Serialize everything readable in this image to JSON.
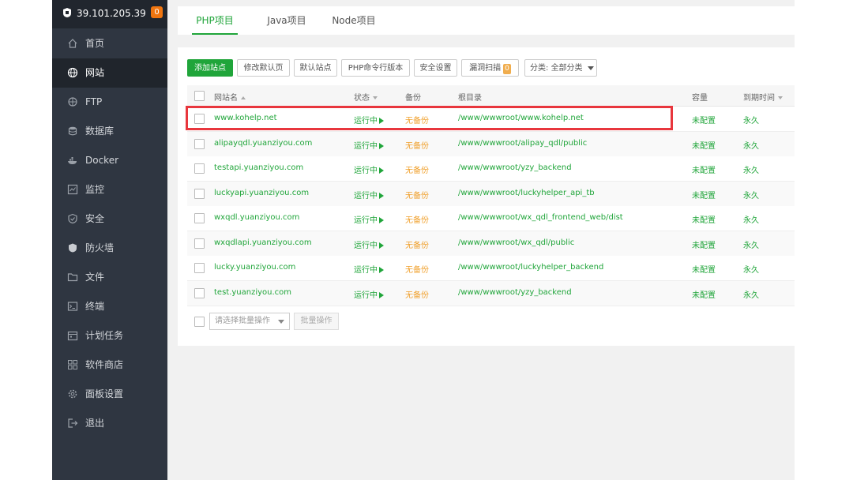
{
  "server": {
    "ip": "39.101.205.39",
    "badge": "0"
  },
  "menu": [
    {
      "label": "首页",
      "icon": "home-icon"
    },
    {
      "label": "网站",
      "icon": "globe-icon",
      "active": true
    },
    {
      "label": "FTP",
      "icon": "ftp-icon"
    },
    {
      "label": "数据库",
      "icon": "database-icon"
    },
    {
      "label": "Docker",
      "icon": "docker-icon"
    },
    {
      "label": "监控",
      "icon": "monitor-icon"
    },
    {
      "label": "安全",
      "icon": "shield-check-icon"
    },
    {
      "label": "防火墙",
      "icon": "firewall-icon"
    },
    {
      "label": "文件",
      "icon": "folder-icon"
    },
    {
      "label": "终端",
      "icon": "terminal-icon"
    },
    {
      "label": "计划任务",
      "icon": "calendar-icon"
    },
    {
      "label": "软件商店",
      "icon": "apps-grid-icon"
    },
    {
      "label": "面板设置",
      "icon": "gear-icon"
    },
    {
      "label": "退出",
      "icon": "logout-icon"
    }
  ],
  "tabs": [
    "PHP项目",
    "Java项目",
    "Node项目"
  ],
  "toolbar": {
    "add_site": "添加站点",
    "edit_default_page": "修改默认页",
    "default_site": "默认站点",
    "php_cli_version": "PHP命令行版本",
    "security_settings": "安全设置",
    "vuln_scan": "漏洞扫描",
    "vuln_count": "0",
    "category_prefix": "分类: ",
    "category_value": "全部分类"
  },
  "table": {
    "headers": {
      "name": "网站名",
      "status": "状态",
      "backup": "备份",
      "root": "根目录",
      "quota": "容量",
      "expire": "到期时间"
    },
    "rows": [
      {
        "name": "www.kohelp.net",
        "status": "运行中",
        "backup": "无备份",
        "root": "/www/wwwroot/www.kohelp.net",
        "quota": "未配置",
        "expire": "永久"
      },
      {
        "name": "alipayqdl.yuanziyou.com",
        "status": "运行中",
        "backup": "无备份",
        "root": "/www/wwwroot/alipay_qdl/public",
        "quota": "未配置",
        "expire": "永久"
      },
      {
        "name": "testapi.yuanziyou.com",
        "status": "运行中",
        "backup": "无备份",
        "root": "/www/wwwroot/yzy_backend",
        "quota": "未配置",
        "expire": "永久"
      },
      {
        "name": "luckyapi.yuanziyou.com",
        "status": "运行中",
        "backup": "无备份",
        "root": "/www/wwwroot/luckyhelper_api_tb",
        "quota": "未配置",
        "expire": "永久"
      },
      {
        "name": "wxqdl.yuanziyou.com",
        "status": "运行中",
        "backup": "无备份",
        "root": "/www/wwwroot/wx_qdl_frontend_web/dist",
        "quota": "未配置",
        "expire": "永久"
      },
      {
        "name": "wxqdlapi.yuanziyou.com",
        "status": "运行中",
        "backup": "无备份",
        "root": "/www/wwwroot/wx_qdl/public",
        "quota": "未配置",
        "expire": "永久"
      },
      {
        "name": "lucky.yuanziyou.com",
        "status": "运行中",
        "backup": "无备份",
        "root": "/www/wwwroot/luckyhelper_backend",
        "quota": "未配置",
        "expire": "永久"
      },
      {
        "name": "test.yuanziyou.com",
        "status": "运行中",
        "backup": "无备份",
        "root": "/www/wwwroot/yzy_backend",
        "quota": "未配置",
        "expire": "永久"
      }
    ]
  },
  "footer": {
    "batch_placeholder": "请选择批量操作",
    "batch_button": "批量操作"
  },
  "colors": {
    "accent": "#20a53a",
    "warning": "#f0a02c",
    "highlight": "#e8363d",
    "sidebar": "#2f3641"
  }
}
